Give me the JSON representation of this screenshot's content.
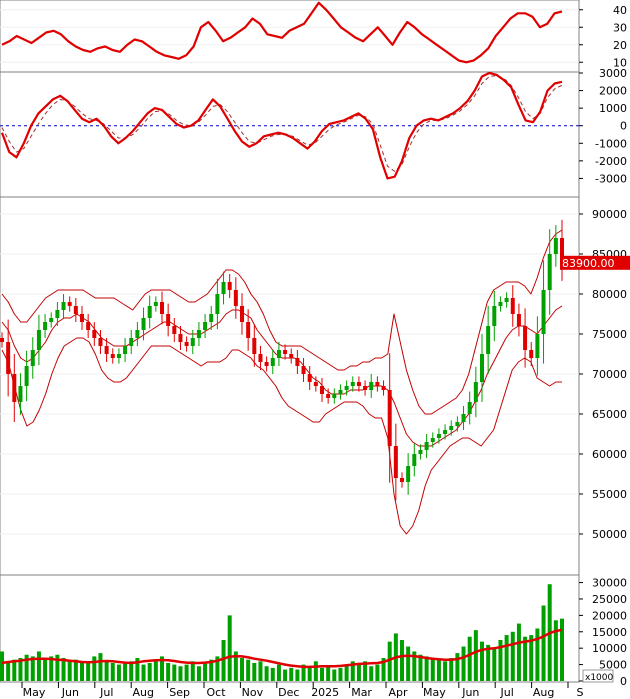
{
  "chart_data": [
    {
      "panel": "oscillator",
      "type": "line",
      "ylim": [
        5,
        45
      ],
      "ticks": [
        10,
        20,
        30,
        40
      ],
      "colors": {
        "line": "#e00000"
      },
      "series": [
        {
          "values": [
            20,
            22,
            25,
            23,
            21,
            24,
            27,
            28,
            26,
            22,
            19,
            17,
            16,
            18,
            19,
            17,
            16,
            20,
            23,
            22,
            19,
            16,
            14,
            13,
            12,
            14,
            19,
            30,
            33,
            28,
            22,
            24,
            27,
            30,
            35,
            32,
            26,
            25,
            24,
            28,
            30,
            32,
            38,
            44,
            40,
            35,
            30,
            27,
            24,
            22,
            26,
            30,
            25,
            20,
            27,
            33,
            30,
            26,
            23,
            20,
            17,
            14,
            11,
            10,
            11,
            14,
            18,
            25,
            30,
            35,
            38,
            38,
            36,
            30,
            32,
            38,
            39
          ]
        }
      ]
    },
    {
      "panel": "macd",
      "type": "line",
      "ylim": [
        -4000,
        3000
      ],
      "ticks": [
        -3000,
        -2000,
        -1000,
        0,
        1000,
        2000,
        3000
      ],
      "colors": {
        "macd": "#e00000",
        "signal": "#a03030",
        "zero": "#0000c0"
      },
      "series": [
        {
          "values": [
            -400,
            -1500,
            -1800,
            -1000,
            0,
            700,
            1100,
            1500,
            1700,
            1400,
            900,
            400,
            200,
            400,
            0,
            -600,
            -1000,
            -700,
            -300,
            200,
            700,
            1000,
            900,
            500,
            100,
            -100,
            0,
            300,
            900,
            1500,
            1100,
            400,
            -300,
            -900,
            -1200,
            -1000,
            -600,
            -500,
            -400,
            -500,
            -700,
            -1000,
            -1300,
            -900,
            -300,
            100,
            200,
            300,
            500,
            700,
            400,
            -200,
            -1800,
            -3000,
            -2900,
            -2000,
            -700,
            0,
            300,
            400,
            300,
            500,
            700,
            1000,
            1400,
            2000,
            2800,
            3000,
            2900,
            2600,
            2200,
            1200,
            300,
            200,
            800,
            2000,
            2400,
            2500
          ]
        },
        {
          "values": [
            -100,
            -900,
            -1500,
            -1300,
            -600,
            100,
            700,
            1200,
            1500,
            1400,
            1100,
            700,
            400,
            300,
            100,
            -300,
            -700,
            -700,
            -500,
            -100,
            400,
            800,
            850,
            650,
            300,
            50,
            0,
            200,
            600,
            1100,
            1200,
            800,
            200,
            -400,
            -900,
            -1000,
            -800,
            -600,
            -500,
            -500,
            -600,
            -850,
            -1100,
            -1000,
            -600,
            -200,
            50,
            200,
            400,
            600,
            500,
            100,
            -1100,
            -2300,
            -2600,
            -2200,
            -1200,
            -400,
            100,
            300,
            300,
            400,
            600,
            850,
            1200,
            1700,
            2400,
            2800,
            2850,
            2700,
            2300,
            1600,
            800,
            400,
            700,
            1600,
            2100,
            2300
          ]
        }
      ]
    },
    {
      "panel": "price",
      "type": "candlestick",
      "ylim": [
        45000,
        92000
      ],
      "ticks": [
        50000,
        55000,
        60000,
        65000,
        70000,
        75000,
        80000,
        85000,
        90000
      ],
      "last_price_label": "83900.00",
      "colors": {
        "up": "#00a000",
        "down": "#e00000",
        "bands": "#c00000",
        "label_bg": "#e00000"
      },
      "close": [
        74000,
        70000,
        66500,
        68500,
        71000,
        73000,
        75500,
        76500,
        77000,
        78000,
        79000,
        78500,
        77500,
        76500,
        75500,
        74500,
        73500,
        72500,
        72000,
        72500,
        73500,
        74500,
        75500,
        77000,
        78500,
        79000,
        77500,
        76000,
        75000,
        74000,
        73500,
        74500,
        75500,
        76500,
        77500,
        80000,
        81500,
        80500,
        78500,
        76500,
        74500,
        72500,
        71500,
        71000,
        72000,
        73000,
        72500,
        72000,
        71000,
        70000,
        69000,
        68500,
        67500,
        67000,
        67500,
        68000,
        68500,
        69000,
        68500,
        68000,
        69000,
        68500,
        68000,
        61000,
        57000,
        56500,
        58500,
        60000,
        60500,
        61500,
        62000,
        62500,
        63000,
        63500,
        64000,
        65000,
        66500,
        69000,
        72500,
        76000,
        78500,
        79000,
        79500,
        77500,
        76000,
        73000,
        72000,
        75000,
        80500,
        85000,
        87000,
        83900
      ],
      "bb_mid": [
        76500,
        75500,
        73500,
        72000,
        71500,
        72000,
        73000,
        74000,
        75500,
        76500,
        77000,
        77000,
        77500,
        77000,
        76500,
        75500,
        74500,
        74000,
        73500,
        73500,
        73500,
        74000,
        74500,
        75000,
        75500,
        76000,
        76500,
        76500,
        76000,
        75500,
        75000,
        75000,
        75000,
        75500,
        76000,
        76500,
        77500,
        78000,
        78000,
        77500,
        77000,
        75500,
        74500,
        73500,
        72500,
        72000,
        72000,
        72000,
        71500,
        70500,
        69500,
        69000,
        68000,
        67500,
        67500,
        67500,
        68000,
        68000,
        68000,
        68500,
        68500,
        68500,
        68000,
        66500,
        64500,
        62500,
        61500,
        61000,
        61000,
        61000,
        61500,
        62000,
        62500,
        63000,
        64000,
        65000,
        66500,
        68000,
        70000,
        71500,
        73000,
        74500,
        75500,
        76000,
        76000,
        75500,
        75000,
        76000,
        77000,
        78000,
        78500
      ],
      "bb_upper": [
        80000,
        79000,
        77500,
        76500,
        76500,
        77500,
        78500,
        79500,
        80000,
        80500,
        80500,
        80500,
        80500,
        80500,
        80000,
        79500,
        79500,
        79500,
        79500,
        79000,
        78500,
        78000,
        79000,
        80000,
        80500,
        80500,
        80500,
        80500,
        80000,
        79500,
        79000,
        79000,
        79500,
        80000,
        81000,
        82000,
        83000,
        83000,
        82500,
        81500,
        80000,
        79000,
        77500,
        75500,
        74000,
        73500,
        73500,
        73500,
        73500,
        73000,
        72500,
        72000,
        71500,
        71000,
        70500,
        70500,
        71000,
        71000,
        71500,
        71500,
        72000,
        72000,
        72500,
        77500,
        74000,
        70500,
        68000,
        66000,
        65000,
        65000,
        65500,
        66000,
        66500,
        67000,
        68000,
        70000,
        73000,
        76000,
        79000,
        80500,
        81000,
        81500,
        81500,
        81500,
        81000,
        80000,
        82000,
        84500,
        86500,
        87500,
        88000
      ],
      "bb_lower": [
        73000,
        71500,
        68500,
        65500,
        63500,
        64000,
        65500,
        67500,
        70000,
        72000,
        73500,
        74000,
        74500,
        74500,
        74000,
        72500,
        70500,
        69500,
        69000,
        69000,
        69500,
        70500,
        71500,
        72500,
        73500,
        73500,
        73500,
        73500,
        73000,
        72500,
        72000,
        71500,
        71000,
        71500,
        71500,
        71500,
        72000,
        73000,
        73000,
        72500,
        72000,
        71000,
        70500,
        69500,
        68500,
        67000,
        66000,
        65500,
        65000,
        64500,
        64000,
        64000,
        65000,
        65500,
        66000,
        66500,
        66500,
        66500,
        66000,
        65000,
        64500,
        64500,
        62000,
        55000,
        51000,
        50000,
        51000,
        53000,
        56000,
        58000,
        59000,
        60000,
        61000,
        61500,
        62000,
        62000,
        61500,
        61000,
        62000,
        63000,
        65500,
        68000,
        70500,
        71500,
        72000,
        71500,
        69500,
        69000,
        68500,
        69000,
        69000
      ]
    },
    {
      "panel": "volume",
      "type": "bar",
      "ylim": [
        0,
        32000
      ],
      "ticks": [
        0,
        5000,
        10000,
        15000,
        20000,
        25000,
        30000
      ],
      "unit_label": "x1000",
      "colors": {
        "bar": "#00a000",
        "ma": "#e00000"
      },
      "x_labels": [
        "May",
        "Jun",
        "Jul",
        "Aug",
        "Sep",
        "Oct",
        "Nov",
        "Dec",
        "2025",
        "Mar",
        "Apr",
        "May",
        "Jun",
        "Jul",
        "Aug",
        "S"
      ],
      "values": [
        9000,
        5500,
        6500,
        7000,
        8000,
        7500,
        9000,
        6500,
        7500,
        8000,
        7000,
        6000,
        6500,
        5500,
        6000,
        7500,
        8500,
        6000,
        5500,
        5000,
        5500,
        6000,
        7000,
        5000,
        5500,
        6500,
        7500,
        5500,
        5000,
        4500,
        5000,
        6000,
        4500,
        5500,
        6500,
        7500,
        12500,
        20000,
        9000,
        7000,
        6500,
        5500,
        6000,
        4500,
        4000,
        5000,
        3500,
        4000,
        3500,
        5000,
        4500,
        6000,
        4000,
        4500,
        3500,
        4000,
        5000,
        6000,
        5500,
        6000,
        4500,
        5000,
        7000,
        12000,
        14500,
        12500,
        10500,
        9000,
        8000,
        7500,
        7000,
        6500,
        6000,
        7000,
        8500,
        10500,
        13500,
        15500,
        12000,
        11000,
        10000,
        12500,
        14000,
        15000,
        17500,
        13500,
        14000,
        16000,
        23000,
        29500,
        18500,
        19000
      ],
      "ma": [
        5500,
        5800,
        6000,
        6200,
        6500,
        6700,
        6800,
        6800,
        6700,
        6500,
        6400,
        6200,
        6000,
        5800,
        5700,
        5800,
        6000,
        6100,
        6000,
        5800,
        5600,
        5500,
        5700,
        6000,
        6200,
        6300,
        6400,
        6300,
        6100,
        5800,
        5600,
        5500,
        5500,
        5600,
        5800,
        6200,
        6800,
        7400,
        7600,
        7500,
        7200,
        6800,
        6500,
        6200,
        5800,
        5400,
        5000,
        4700,
        4500,
        4300,
        4300,
        4400,
        4500,
        4500,
        4500,
        4600,
        4800,
        5000,
        5200,
        5300,
        5400,
        5500,
        5800,
        6500,
        7200,
        7600,
        7700,
        7600,
        7300,
        7000,
        6800,
        6600,
        6500,
        6500,
        6700,
        7200,
        8000,
        8900,
        9500,
        9800,
        10000,
        10300,
        10800,
        11200,
        11700,
        12000,
        12300,
        12800,
        13600,
        14600,
        15200,
        15600
      ]
    }
  ]
}
